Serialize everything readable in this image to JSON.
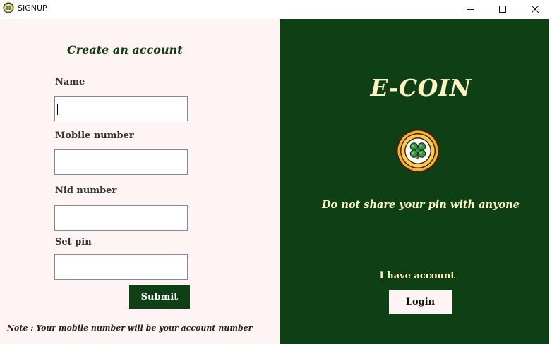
{
  "window": {
    "title": "SIGNUP",
    "app_icon": "clover-coin-icon",
    "controls": [
      "minimize-icon",
      "maximize-icon",
      "close-icon"
    ]
  },
  "form": {
    "heading": "Create an account",
    "fields": [
      {
        "label": "Name",
        "value": ""
      },
      {
        "label": "Mobile number",
        "value": ""
      },
      {
        "label": "Nid number",
        "value": ""
      },
      {
        "label": "Set pin",
        "value": ""
      }
    ],
    "submit_label": "Submit",
    "note": "Note : Your mobile number will be your account number"
  },
  "side": {
    "brand": "E-COIN",
    "logo_icon": "clover-coin-icon",
    "warning": "Do not share your pin with anyone",
    "account_prompt": "I have account",
    "login_label": "Login"
  },
  "colors": {
    "panel_green": "#0f3f14",
    "panel_pink": "#fff4f4",
    "text_cream": "#fff3c2"
  }
}
